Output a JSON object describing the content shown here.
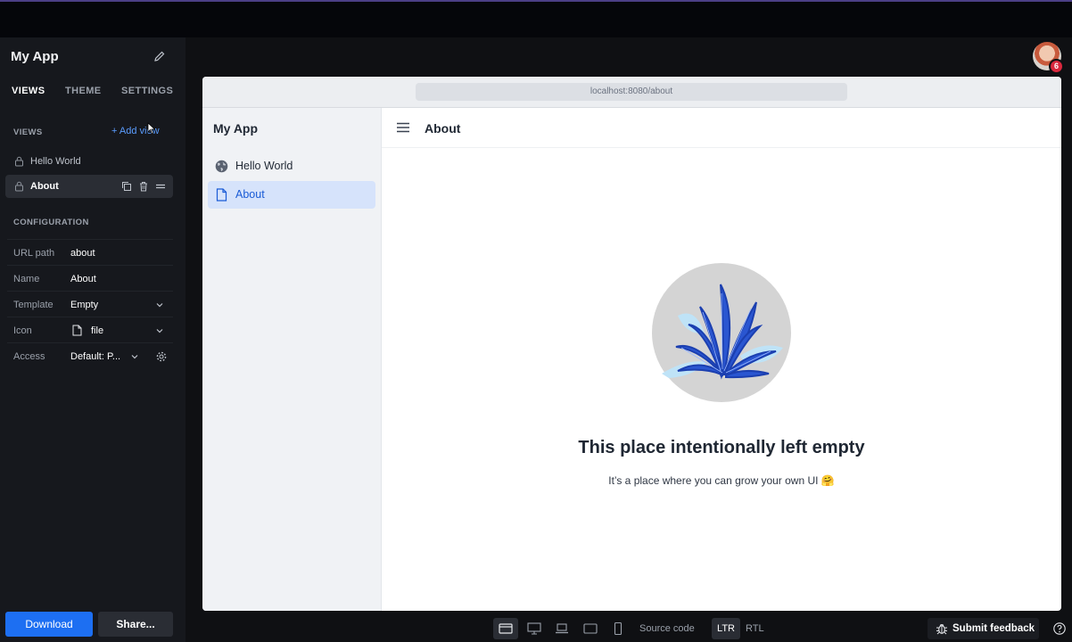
{
  "sidebar": {
    "app_title": "My App",
    "tabs": [
      "VIEWS",
      "THEME",
      "SETTINGS"
    ],
    "views_label": "VIEWS",
    "add_view": "+ Add view",
    "views": [
      {
        "label": "Hello World"
      },
      {
        "label": "About"
      }
    ],
    "config_label": "CONFIGURATION",
    "config": {
      "url_path": {
        "key": "URL path",
        "value": "about"
      },
      "name": {
        "key": "Name",
        "value": "About"
      },
      "template": {
        "key": "Template",
        "value": "Empty"
      },
      "icon": {
        "key": "Icon",
        "value": "file"
      },
      "access": {
        "key": "Access",
        "value": "Default: P..."
      }
    },
    "download": "Download",
    "share": "Share..."
  },
  "avatar": {
    "badge": "6"
  },
  "preview": {
    "url": "localhost:8080/about",
    "drawer_title": "My App",
    "nav": [
      {
        "label": "Hello World",
        "icon": "globe-icon"
      },
      {
        "label": "About",
        "icon": "file-icon"
      }
    ],
    "header_title": "About",
    "empty_title": "This place intentionally left empty",
    "empty_subtitle": "It’s a place where you can grow your own UI 🤗"
  },
  "bottombar": {
    "source_code": "Source code",
    "ltr": "LTR",
    "rtl": "RTL",
    "submit_feedback": "Submit feedback"
  },
  "colors": {
    "accent": "#1d6ff2",
    "link": "#5b9dff",
    "nav_active_bg": "#d6e3fb",
    "badge": "#d9273d"
  }
}
